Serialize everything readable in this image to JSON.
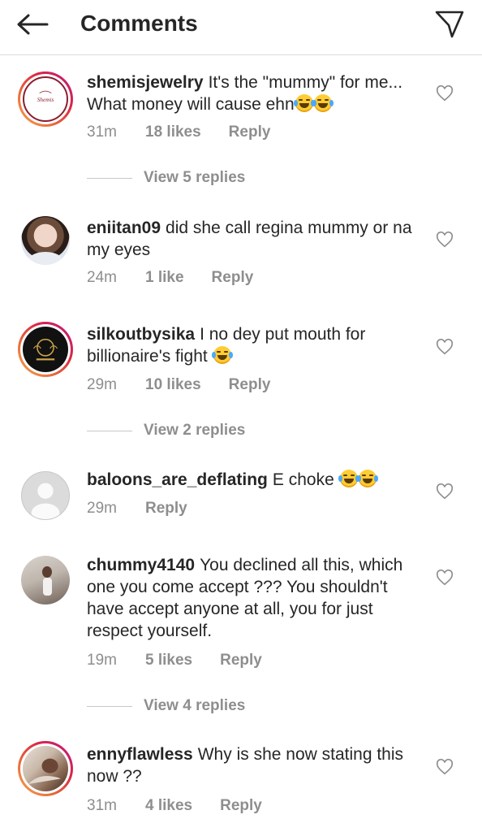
{
  "header": {
    "title": "Comments",
    "back_icon": "arrow-left-icon",
    "share_icon": "paper-plane-icon"
  },
  "comments": [
    {
      "username": "shemisjewelry",
      "text": "It's the \"mummy\" for me... What money will cause ehn",
      "emojis": 2,
      "time": "31m",
      "likes": "18 likes",
      "reply": "Reply",
      "view_replies": "View 5 replies",
      "avatar": "shemis-logo"
    },
    {
      "username": "eniitan09",
      "text": "did she call regina  mummy or na my eyes",
      "emojis": 0,
      "time": "24m",
      "likes": "1 like",
      "reply": "Reply",
      "avatar": "profile-photo"
    },
    {
      "username": "silkoutbysika",
      "text": "I no dey put mouth for billionaire's fight",
      "emojis": 1,
      "time": "29m",
      "likes": "10 likes",
      "reply": "Reply",
      "view_replies": "View 2 replies",
      "avatar": "silkout-logo"
    },
    {
      "username": "baloons_are_deflating",
      "text": "E choke",
      "emojis": 2,
      "time": "29m",
      "likes": "",
      "reply": "Reply",
      "avatar": "default-avatar"
    },
    {
      "username": "chummy4140",
      "text": "You declined all this, which one you come accept ??? You shouldn't have accept anyone at all, you for just respect yourself.",
      "emojis": 0,
      "time": "19m",
      "likes": "5 likes",
      "reply": "Reply",
      "view_replies": "View 4 replies",
      "avatar": "profile-photo"
    },
    {
      "username": "ennyflawless",
      "text": "Why is she now stating this now ??",
      "emojis": 0,
      "time": "31m",
      "likes": "4 likes",
      "reply": "Reply",
      "avatar": "profile-photo"
    }
  ],
  "colors": {
    "text": "#262626",
    "muted": "#8e8e8e",
    "divider": "#dbdbdb"
  }
}
